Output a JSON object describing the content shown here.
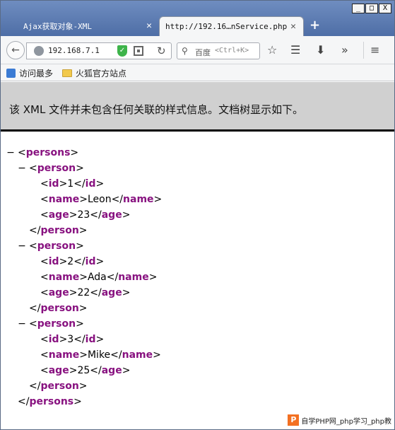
{
  "browser": {
    "tabs": [
      {
        "label": "Ajax获取对象-XML"
      },
      {
        "label": "http://192.16…nService.php"
      }
    ],
    "url": "192.168.7.1",
    "search": {
      "engine": "百度",
      "hint": "<Ctrl+K>"
    },
    "window_controls": {
      "minimize": "_",
      "maximize": "□",
      "close": "X"
    },
    "new_tab": "+",
    "bookmarks": [
      {
        "label": "访问最多"
      },
      {
        "label": "火狐官方站点"
      }
    ]
  },
  "page": {
    "info_message": "该 XML 文件并未包含任何关联的样式信息。文档树显示如下。",
    "root": "persons",
    "persons": [
      {
        "id": "1",
        "name": "Leon",
        "age": "23"
      },
      {
        "id": "2",
        "name": "Ada",
        "age": "22"
      },
      {
        "id": "3",
        "name": "Mike",
        "age": "25"
      }
    ],
    "child_tag": "person",
    "fields": {
      "id": "id",
      "name": "name",
      "age": "age"
    },
    "toggle_symbol": "−"
  },
  "watermark": {
    "logo": "P",
    "text": "自学PHP网_php学习_php教"
  }
}
